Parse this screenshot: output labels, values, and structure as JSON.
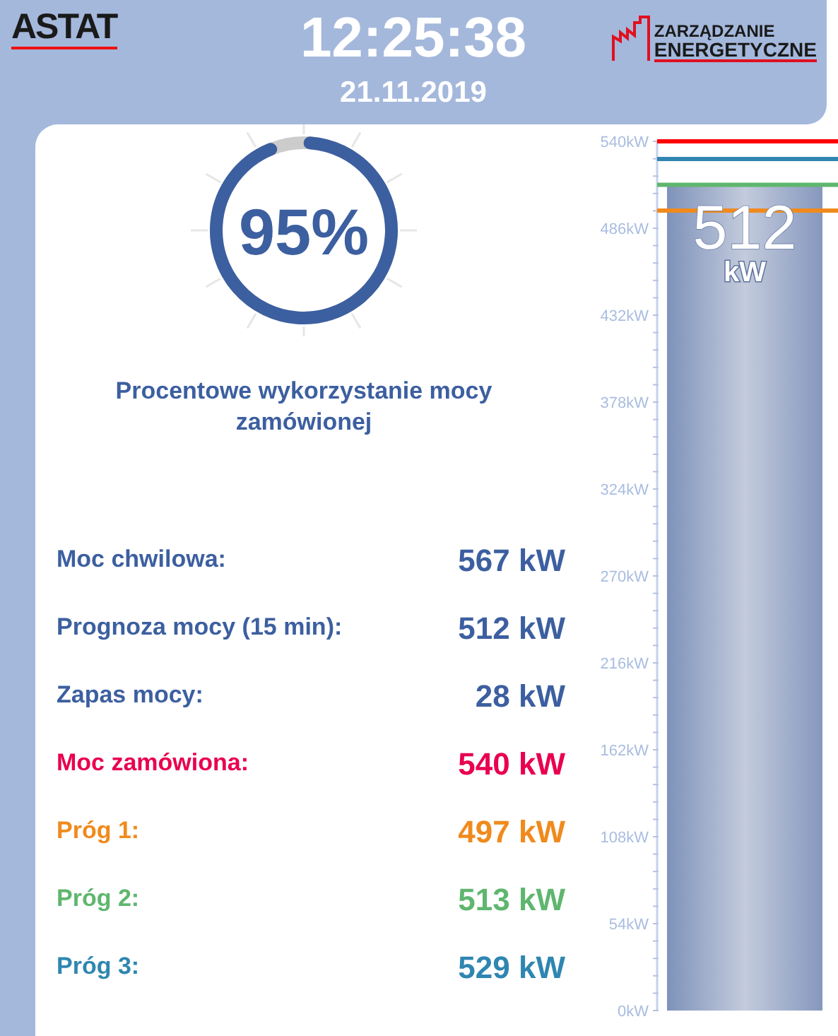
{
  "header": {
    "logo_left": "ASTAT",
    "time": "12:25:38",
    "date": "21.11.2019",
    "logo_right": [
      "ZARZĄDZANIE",
      "ENERGETYCZNE"
    ]
  },
  "gauge": {
    "value": "95%",
    "title": "Procentowe wykorzystanie mocy zamówionej"
  },
  "readings": [
    {
      "label": "Moc chwilowa:",
      "value": "567 kW",
      "color": "#3c5fa0"
    },
    {
      "label": "Prognoza mocy (15 min):",
      "value": "512 kW",
      "color": "#3c5fa0"
    },
    {
      "label": "Zapas mocy:",
      "value": "28 kW",
      "color": "#3c5fa0"
    },
    {
      "label": "Moc zamówiona:",
      "value": "540 kW",
      "color": "#e8004f"
    },
    {
      "label": "Próg 1:",
      "value": "497 kW",
      "color": "#f08a1c"
    },
    {
      "label": "Próg 2:",
      "value": "513 kW",
      "color": "#5fb66e"
    },
    {
      "label": "Próg 3:",
      "value": "529 kW",
      "color": "#2f86b0"
    }
  ],
  "chart": {
    "bar_label": "512",
    "bar_unit": "kW",
    "chart_data": {
      "type": "bar",
      "values": [
        512
      ],
      "ylim": [
        0,
        540
      ],
      "yticks": [
        {
          "value": 0,
          "label": "0kW"
        },
        {
          "value": 54,
          "label": "54kW"
        },
        {
          "value": 108,
          "label": "108kW"
        },
        {
          "value": 162,
          "label": "162kW"
        },
        {
          "value": 216,
          "label": "216kW"
        },
        {
          "value": 270,
          "label": "270kW"
        },
        {
          "value": 324,
          "label": "324kW"
        },
        {
          "value": 378,
          "label": "378kW"
        },
        {
          "value": 432,
          "label": "432kW"
        },
        {
          "value": 486,
          "label": "486kW"
        },
        {
          "value": 540,
          "label": "540kW"
        }
      ],
      "ref_lines": [
        {
          "axis": "y",
          "value": 540,
          "color": "#ff0000"
        },
        {
          "axis": "y",
          "value": 529,
          "color": "#2f86b0"
        },
        {
          "axis": "y",
          "value": 513,
          "color": "#5fb66e"
        },
        {
          "axis": "y",
          "value": 497,
          "color": "#f08a1c"
        }
      ]
    }
  }
}
